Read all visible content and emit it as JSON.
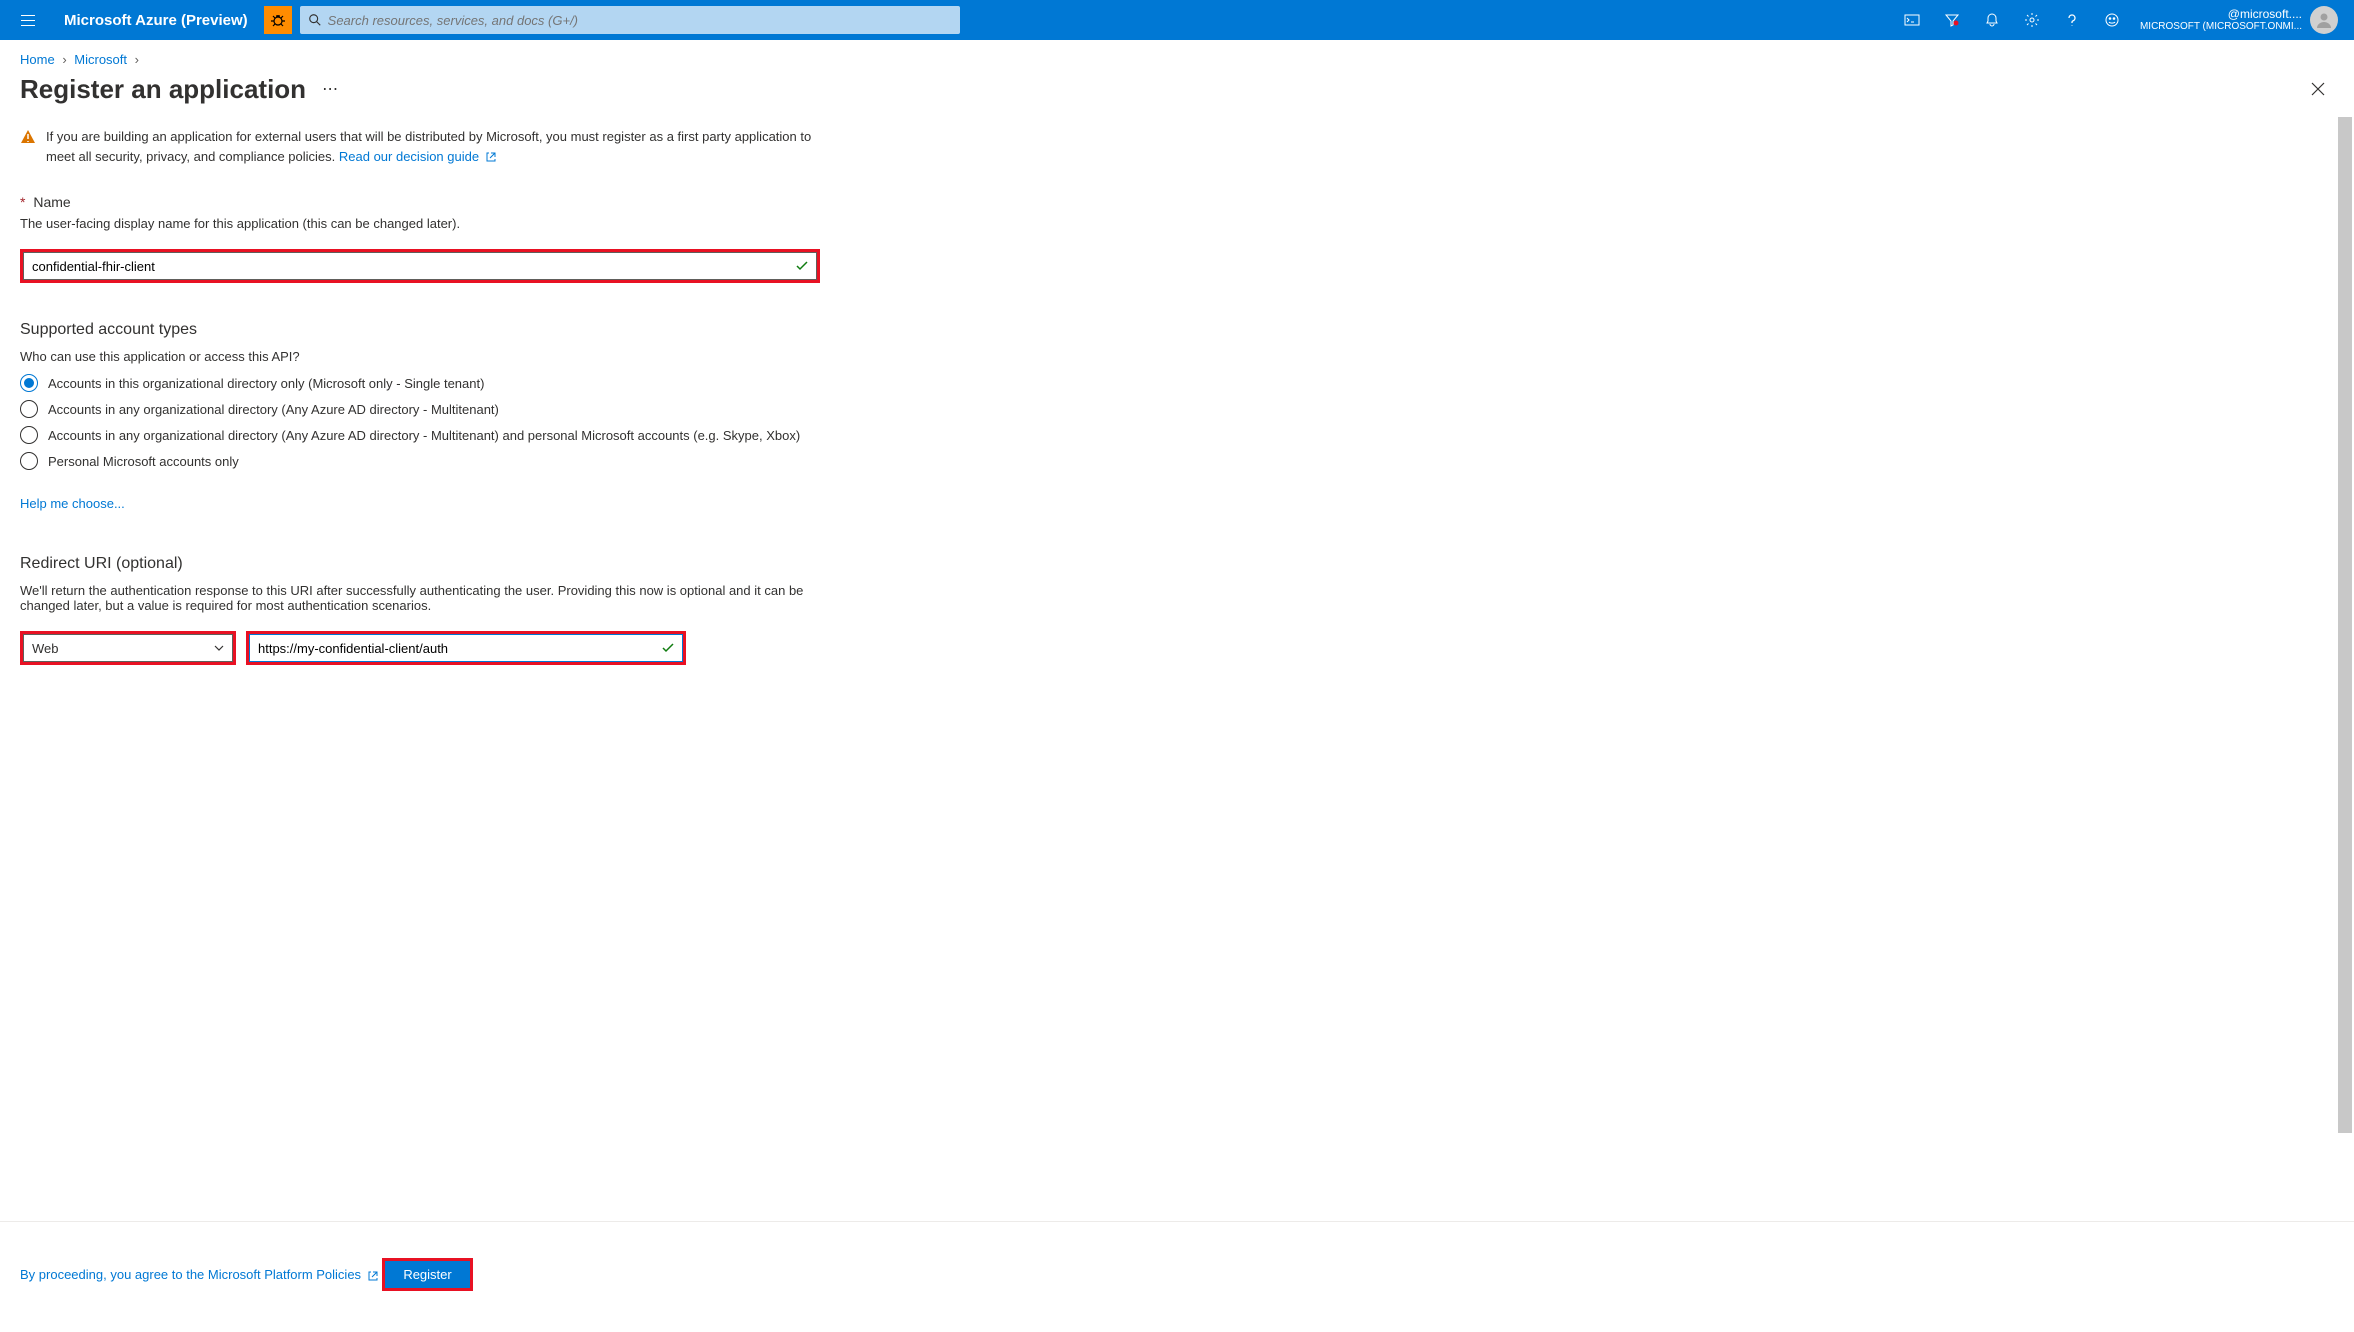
{
  "header": {
    "brand": "Microsoft Azure (Preview)",
    "search_placeholder": "Search resources, services, and docs (G+/)",
    "account_email": "@microsoft....",
    "account_tenant": "MICROSOFT (MICROSOFT.ONMI..."
  },
  "breadcrumb": {
    "items": [
      "Home",
      "Microsoft"
    ]
  },
  "page": {
    "title": "Register an application"
  },
  "warning": {
    "text": "If you are building an application for external users that will be distributed by Microsoft, you must register as a first party application to meet all security, privacy, and compliance policies. ",
    "link": "Read our decision guide"
  },
  "name_section": {
    "label": "Name",
    "desc": "The user-facing display name for this application (this can be changed later).",
    "value": "confidential-fhir-client"
  },
  "account_types": {
    "heading": "Supported account types",
    "desc": "Who can use this application or access this API?",
    "options": [
      "Accounts in this organizational directory only (Microsoft only - Single tenant)",
      "Accounts in any organizational directory (Any Azure AD directory - Multitenant)",
      "Accounts in any organizational directory (Any Azure AD directory - Multitenant) and personal Microsoft accounts (e.g. Skype, Xbox)",
      "Personal Microsoft accounts only"
    ],
    "selected_index": 0,
    "help_link": "Help me choose..."
  },
  "redirect": {
    "heading": "Redirect URI (optional)",
    "desc": "We'll return the authentication response to this URI after successfully authenticating the user. Providing this now is optional and it can be changed later, but a value is required for most authentication scenarios.",
    "platform": "Web",
    "uri": "https://my-confidential-client/auth"
  },
  "footer": {
    "policy_text": "By proceeding, you agree to the Microsoft Platform Policies",
    "register": "Register"
  }
}
